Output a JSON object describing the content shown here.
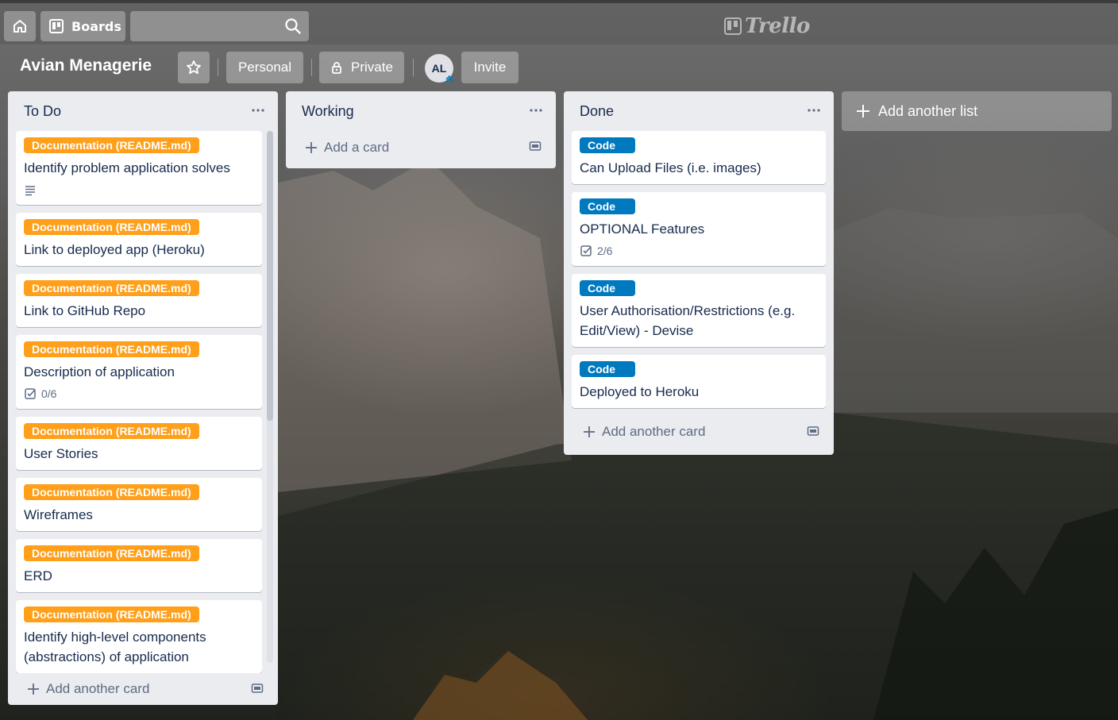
{
  "topbar": {
    "boards_label": "Boards",
    "search_placeholder": "",
    "logo_text": "Trello"
  },
  "board": {
    "title": "Avian Menagerie",
    "visibility_team": "Personal",
    "visibility_privacy": "Private",
    "member_initials": "AL",
    "invite_label": "Invite"
  },
  "lists": [
    {
      "name": "To Do",
      "cards": [
        {
          "label": "Documentation (README.md)",
          "label_color": "#ff9f1a",
          "title": "Identify problem application solves",
          "has_description": true
        },
        {
          "label": "Documentation (README.md)",
          "label_color": "#ff9f1a",
          "title": "Link to deployed app (Heroku)"
        },
        {
          "label": "Documentation (README.md)",
          "label_color": "#ff9f1a",
          "title": "Link to GitHub Repo"
        },
        {
          "label": "Documentation (README.md)",
          "label_color": "#ff9f1a",
          "title": "Description of application",
          "checklist": "0/6"
        },
        {
          "label": "Documentation (README.md)",
          "label_color": "#ff9f1a",
          "title": "User Stories"
        },
        {
          "label": "Documentation (README.md)",
          "label_color": "#ff9f1a",
          "title": "Wireframes"
        },
        {
          "label": "Documentation (README.md)",
          "label_color": "#ff9f1a",
          "title": "ERD"
        },
        {
          "label": "Documentation (README.md)",
          "label_color": "#ff9f1a",
          "title": "Identify high-level components (abstractions) of application"
        }
      ],
      "add_label": "Add another card"
    },
    {
      "name": "Working",
      "cards": [],
      "add_label": "Add a card"
    },
    {
      "name": "Done",
      "cards": [
        {
          "label": "Code",
          "label_color": "#0079bf",
          "title": "Can Upload Files (i.e. images)"
        },
        {
          "label": "Code",
          "label_color": "#0079bf",
          "title": "OPTIONAL Features",
          "checklist": "2/6"
        },
        {
          "label": "Code",
          "label_color": "#0079bf",
          "title": "User Authorisation/Restrictions (e.g. Edit/View) - Devise"
        },
        {
          "label": "Code",
          "label_color": "#0079bf",
          "title": "Deployed to Heroku"
        }
      ],
      "add_label": "Add another card"
    }
  ],
  "add_list_label": "Add another list",
  "icons": [
    "home-icon",
    "boards-icon",
    "search-icon",
    "star-icon",
    "lock-icon",
    "ellipsis-icon",
    "plus-icon",
    "card-template-icon",
    "description-icon",
    "checklist-icon"
  ]
}
